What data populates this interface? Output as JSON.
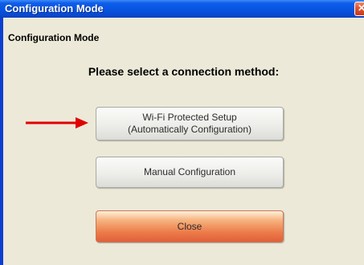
{
  "window": {
    "title": "Configuration Mode",
    "close_glyph": "✕",
    "title_bar_color": "#0a49d0"
  },
  "content": {
    "section_label": "Configuration Mode",
    "prompt": "Please select a connection method:",
    "arrow": {
      "icon": "arrow-right-icon",
      "color": "#e00000"
    }
  },
  "buttons": {
    "wps_line1": "Wi-Fi Protected Setup",
    "wps_line2": "(Automatically Configuration)",
    "manual": "Manual Configuration",
    "close": "Close",
    "close_color": "#ec7a48"
  }
}
